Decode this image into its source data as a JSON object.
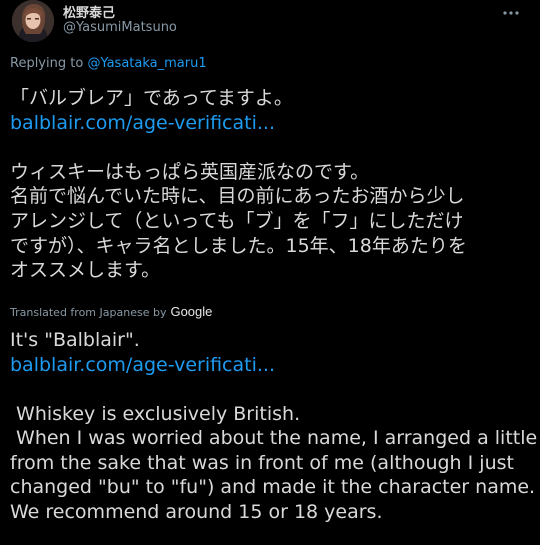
{
  "user": {
    "display_name": "松野泰己",
    "handle": "@YasumiMatsuno"
  },
  "reply": {
    "prefix": "Replying to",
    "to": "@Yasataka_maru1"
  },
  "original": {
    "line1": "「バルブレア」であってますよ。",
    "link": "balblair.com/age-verificati...",
    "line3": "ウィスキーはもっぱら英国産派なのです。",
    "line4": "名前で悩んでいた時に、目の前にあったお酒から少し",
    "line5": "アレンジして（といっても「ブ」を「フ」にしただけ",
    "line6": "ですが）、キャラ名としました。15年、18年あたりを",
    "line7": "オススメします。"
  },
  "translation": {
    "label": "Translated from Japanese by",
    "provider": "Google"
  },
  "translated": {
    "line1": "It's \"Balblair\".",
    "link": "balblair.com/age-verificati...",
    "line3": " Whiskey is exclusively British.",
    "line4": " When I was worried about the name, I arranged a little",
    "line5": "from the sake that was in front of me (although I just",
    "line6": "changed \"bu\" to \"fu\") and made it the character name.",
    "line7": "We recommend around 15 or 18 years."
  },
  "colors": {
    "background": "#000000",
    "text": "#d9d9d9",
    "secondary": "#8899a6",
    "link": "#1d9bf0"
  },
  "icons": {
    "more": "more-horizontal-icon",
    "avatar": "avatar"
  }
}
